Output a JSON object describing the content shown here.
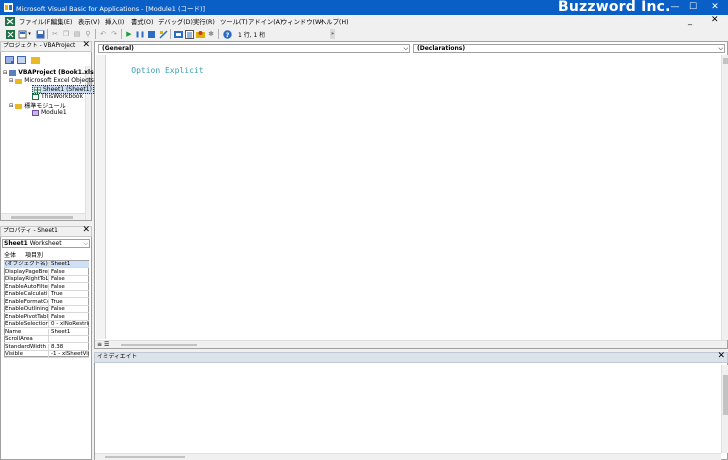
{
  "window": {
    "title": "Microsoft Visual Basic for Applications - [Module1 (コード)]",
    "brand": "Buzzword Inc.",
    "controls": {
      "minimize": "—",
      "maximize": "☐",
      "close": "✕"
    }
  },
  "menu": {
    "items": [
      "ファイル(F)",
      "編集(E)",
      "表示(V)",
      "挿入(I)",
      "書式(O)",
      "デバッグ(D)",
      "実行(R)",
      "ツール(T)",
      "アドイン(A)",
      "ウィンドウ(W)",
      "ヘルプ(H)"
    ],
    "mdi_min": "_",
    "mdi_close": "✕"
  },
  "toolbar": {
    "position": "1 行, 1 桁"
  },
  "project": {
    "title": "プロジェクト - VBAProject",
    "tree": {
      "root": "VBAProject (Book1.xlsm)",
      "excel_objects": "Microsoft Excel Objects",
      "sheet1": "Sheet1 (Sheet1)",
      "thisworkbook": "ThisWorkbook",
      "modules": "標準モジュール",
      "module1": "Module1"
    }
  },
  "properties": {
    "title": "プロパティ - Sheet1",
    "object_name": "Sheet1",
    "object_type": "Worksheet",
    "tabs": [
      "全体",
      "項目別"
    ],
    "rows": [
      {
        "k": "(オブジェクト名)",
        "v": "Sheet1"
      },
      {
        "k": "DisplayPageBreaks",
        "v": "False"
      },
      {
        "k": "DisplayRightToLeft",
        "v": "False"
      },
      {
        "k": "EnableAutoFilter",
        "v": "False"
      },
      {
        "k": "EnableCalculation",
        "v": "True"
      },
      {
        "k": "EnableFormatConditionsCalculation",
        "v": "True"
      },
      {
        "k": "EnableOutlining",
        "v": "False"
      },
      {
        "k": "EnablePivotTable",
        "v": "False"
      },
      {
        "k": "EnableSelection",
        "v": "0 - xlNoRestrictions"
      },
      {
        "k": "Name",
        "v": "Sheet1"
      },
      {
        "k": "ScrollArea",
        "v": ""
      },
      {
        "k": "StandardWidth",
        "v": "8.38"
      },
      {
        "k": "Visible",
        "v": "-1 - xlSheetVisible"
      }
    ]
  },
  "code": {
    "object_combo": "(General)",
    "proc_combo": "(Declarations)",
    "text": "Option Explicit",
    "text_color": "#3a9cb4"
  },
  "immediate": {
    "title": "イミディエイト"
  }
}
